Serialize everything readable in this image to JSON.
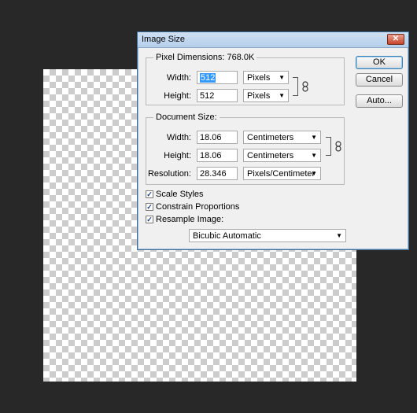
{
  "dialog": {
    "title": "Image Size",
    "close_glyph": "✕",
    "buttons": {
      "ok": "OK",
      "cancel": "Cancel",
      "auto": "Auto..."
    }
  },
  "pixel_dimensions": {
    "label": "Pixel Dimensions:",
    "size": "768.0K",
    "width_label": "Width:",
    "width_value": "512",
    "width_unit": "Pixels",
    "height_label": "Height:",
    "height_value": "512",
    "height_unit": "Pixels"
  },
  "document_size": {
    "label": "Document Size:",
    "width_label": "Width:",
    "width_value": "18.06",
    "width_unit": "Centimeters",
    "height_label": "Height:",
    "height_value": "18.06",
    "height_unit": "Centimeters",
    "resolution_label": "Resolution:",
    "resolution_value": "28.346",
    "resolution_unit": "Pixels/Centimeter"
  },
  "options": {
    "scale_styles": {
      "label": "Scale Styles",
      "checked": true
    },
    "constrain_proportions": {
      "label": "Constrain Proportions",
      "checked": true
    },
    "resample_image": {
      "label": "Resample Image:",
      "checked": true
    },
    "resample_method": "Bicubic Automatic"
  },
  "icons": {
    "dropdown_arrow": "▼",
    "check": "✓",
    "link": "chain-link-icon"
  }
}
